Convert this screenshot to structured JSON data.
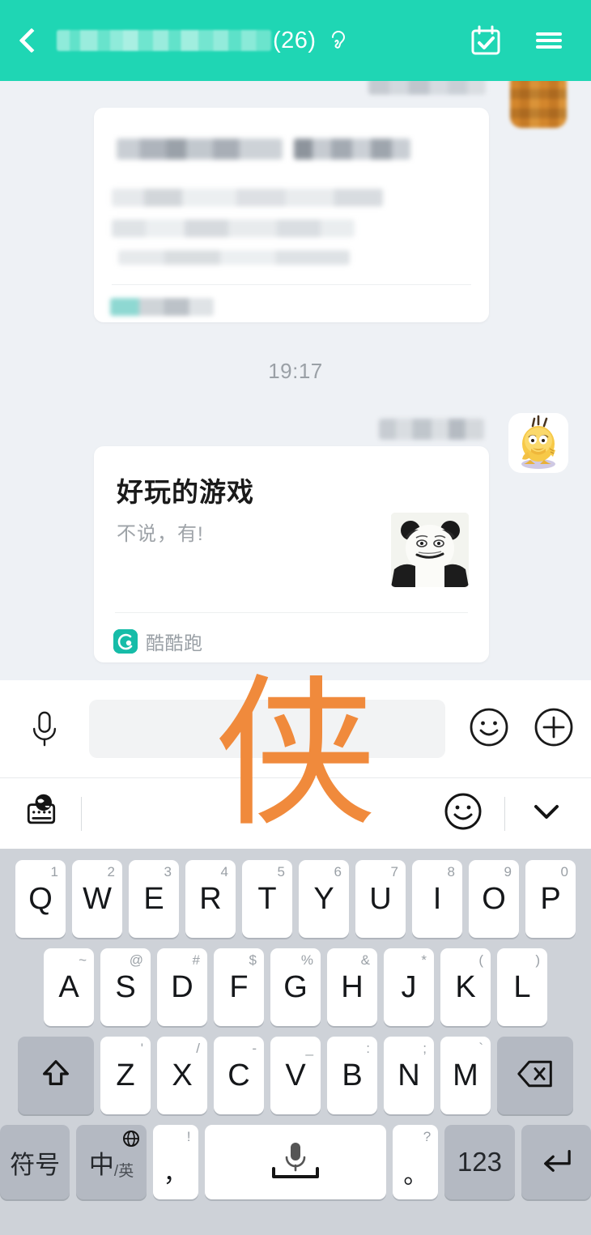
{
  "header": {
    "back_icon": "back-chevron-icon",
    "group_name_masked": "",
    "member_count": "(26)",
    "ear_icon": "ear-icon",
    "calendar_icon": "calendar-check-icon",
    "menu_icon": "hamburger-menu-icon",
    "bg_color": "#1FD6B4"
  },
  "chat": {
    "timestamp": "19:17",
    "blurred_card": {
      "note": "mosaic-obscured link card"
    },
    "message": {
      "avatar_name": "psyduck-avatar",
      "card_title": "好玩的游戏",
      "card_subtitle": "不说，有!",
      "card_thumb": "panda-meme-thumbnail",
      "source_app": "酷酷跑",
      "source_icon_color": "#16BCA8"
    }
  },
  "input_bar": {
    "mic_icon": "microphone-icon",
    "input_value": "",
    "input_placeholder": "",
    "emoji_icon": "emoji-smiley-icon",
    "plus_icon": "plus-circle-icon"
  },
  "ime_toolbar": {
    "language_icon": "globe-keyboard-icon",
    "emoji_icon": "emoji-smiley-icon",
    "collapse_icon": "chevron-down-icon"
  },
  "ime_overlay": {
    "handwriting_char": "侠",
    "color": "#F08A3C"
  },
  "keyboard": {
    "row1": [
      {
        "main": "Q",
        "hint": "1"
      },
      {
        "main": "W",
        "hint": "2"
      },
      {
        "main": "E",
        "hint": "3"
      },
      {
        "main": "R",
        "hint": "4"
      },
      {
        "main": "T",
        "hint": "5"
      },
      {
        "main": "Y",
        "hint": "6"
      },
      {
        "main": "U",
        "hint": "7"
      },
      {
        "main": "I",
        "hint": "8"
      },
      {
        "main": "O",
        "hint": "9"
      },
      {
        "main": "P",
        "hint": "0"
      }
    ],
    "row2": [
      {
        "main": "A",
        "hint": "~"
      },
      {
        "main": "S",
        "hint": "@"
      },
      {
        "main": "D",
        "hint": "#"
      },
      {
        "main": "F",
        "hint": "$"
      },
      {
        "main": "G",
        "hint": "%"
      },
      {
        "main": "H",
        "hint": "&"
      },
      {
        "main": "J",
        "hint": "*"
      },
      {
        "main": "K",
        "hint": "("
      },
      {
        "main": "L",
        "hint": ")"
      }
    ],
    "row3": [
      {
        "main": "Z",
        "hint": "'"
      },
      {
        "main": "X",
        "hint": "/"
      },
      {
        "main": "C",
        "hint": "-"
      },
      {
        "main": "V",
        "hint": "_"
      },
      {
        "main": "B",
        "hint": ":"
      },
      {
        "main": "N",
        "hint": ";"
      },
      {
        "main": "M",
        "hint": "`"
      }
    ],
    "shift_icon": "shift-arrow-icon",
    "backspace_icon": "backspace-icon",
    "symbol_key": "符号",
    "lang_key_main": "中",
    "lang_key_sub": "/英",
    "lang_key_icon": "globe-icon",
    "comma_key": "，",
    "comma_hint": "!",
    "space_icon": "microphone-icon",
    "period_key": "。",
    "period_hint": "?",
    "number_key": "123",
    "enter_icon": "enter-arrow-icon",
    "key_bg": "#FFFFFF",
    "fn_key_bg": "#B4B9C2",
    "keyboard_bg": "#CED2D8"
  }
}
